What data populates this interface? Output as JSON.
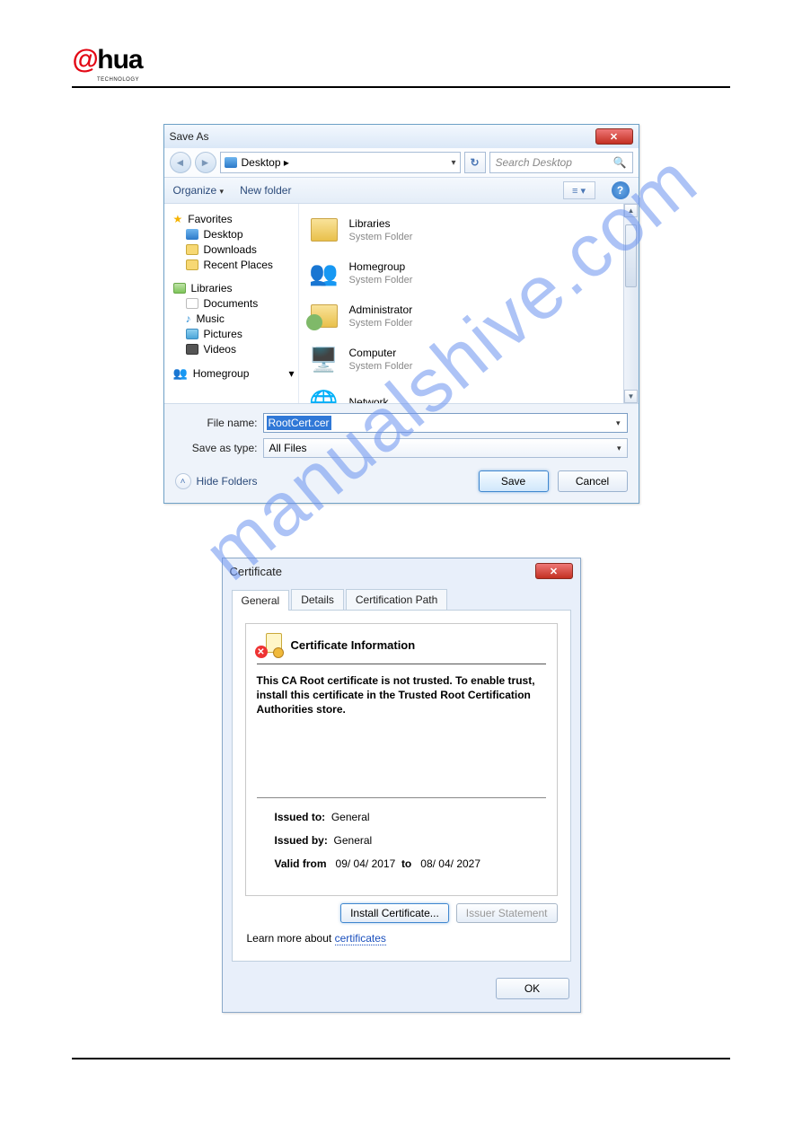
{
  "watermark": "manualshive.com",
  "saveas": {
    "title": "Save As",
    "breadcrumb": "Desktop ▸",
    "search_placeholder": "Search Desktop",
    "organize": "Organize",
    "new_folder": "New folder",
    "sidebar": {
      "favorites": "Favorites",
      "desktop": "Desktop",
      "downloads": "Downloads",
      "recent": "Recent Places",
      "libraries": "Libraries",
      "documents": "Documents",
      "music": "Music",
      "pictures": "Pictures",
      "videos": "Videos",
      "homegroup": "Homegroup"
    },
    "items": {
      "libraries": {
        "name": "Libraries",
        "type": "System Folder"
      },
      "homegroup": {
        "name": "Homegroup",
        "type": "System Folder"
      },
      "admin": {
        "name": "Administrator",
        "type": "System Folder"
      },
      "computer": {
        "name": "Computer",
        "type": "System Folder"
      },
      "network": {
        "name": "Network",
        "type": ""
      }
    },
    "filename_label": "File name:",
    "filename_value": "RootCert.cer",
    "saveas_label": "Save as type:",
    "saveas_value": "All Files",
    "hide_folders": "Hide Folders",
    "save": "Save",
    "cancel": "Cancel"
  },
  "cert": {
    "title": "Certificate",
    "tabs": {
      "general": "General",
      "details": "Details",
      "path": "Certification Path"
    },
    "heading": "Certificate Information",
    "message": "This CA Root certificate is not trusted. To enable trust, install this certificate in the Trusted Root Certification Authorities store.",
    "issued_to_label": "Issued to:",
    "issued_to": "General",
    "issued_by_label": "Issued by:",
    "issued_by": "General",
    "valid_from_label": "Valid from",
    "valid_from": "09/ 04/ 2017",
    "to_label": "to",
    "valid_to": "08/ 04/ 2027",
    "install": "Install Certificate...",
    "issuer_stmt": "Issuer Statement",
    "learn": "Learn more about",
    "learn_link": "certificates",
    "ok": "OK"
  }
}
